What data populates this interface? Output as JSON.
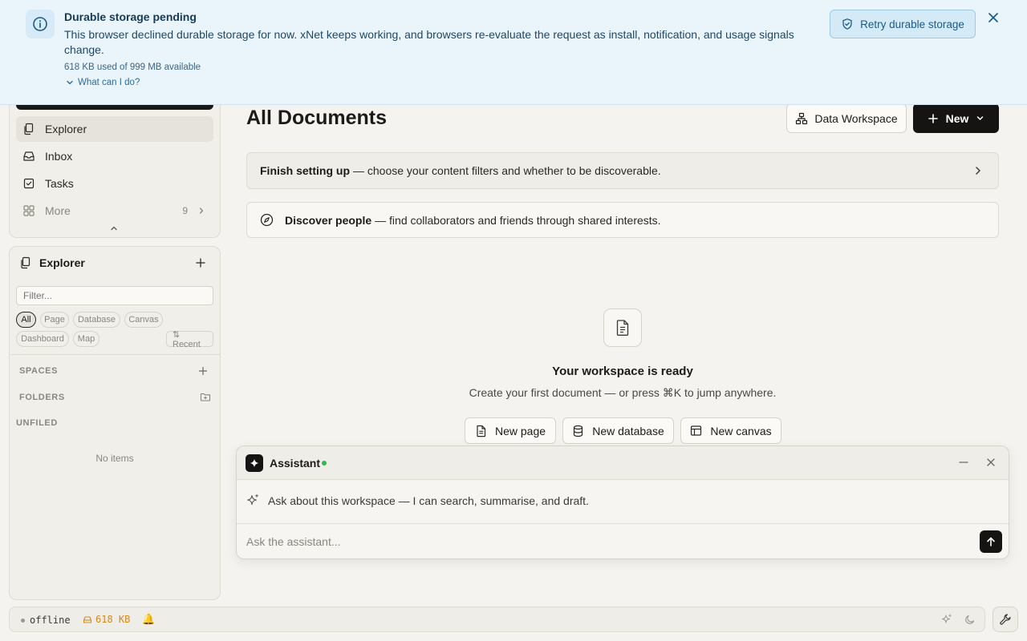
{
  "banner": {
    "title": "Durable storage pending",
    "message": "This browser declined durable storage for now. xNet keeps working, and browsers re-evaluate the request as install, notification, and usage signals change.",
    "usage": "618 KB used of 999 MB available",
    "what_can_i_do": "What can I do?",
    "retry_label": "Retry durable storage",
    "icon": "info-icon"
  },
  "sidebar": {
    "nav": [
      {
        "label": "Explorer",
        "icon": "files-icon",
        "active": true
      },
      {
        "label": "Inbox",
        "icon": "inbox-icon"
      },
      {
        "label": "Tasks",
        "icon": "checkbox-icon"
      },
      {
        "label": "More",
        "icon": "grid-icon",
        "count": "9"
      }
    ],
    "explorer": {
      "title": "Explorer",
      "filter_placeholder": "Filter...",
      "chips": [
        "All",
        "Page",
        "Database",
        "Canvas",
        "Dashboard",
        "Map"
      ],
      "sort_label": "⇅ Recent",
      "spaces_label": "SPACES",
      "folders_label": "FOLDERS",
      "unfiled_label": "UNFILED",
      "empty_text": "No items"
    }
  },
  "main": {
    "title": "All Documents",
    "data_workspace_label": "Data Workspace",
    "new_label": "New",
    "setup_bold": "Finish setting up",
    "setup_text": "— choose your content filters and whether to be discoverable.",
    "discover_bold": "Discover people",
    "discover_text": "— find collaborators and friends through shared interests.",
    "empty_title": "Your workspace is ready",
    "empty_subtitle": "Create your first document — or press ⌘K to jump anywhere.",
    "create_buttons": [
      {
        "label": "New page",
        "icon": "page-icon"
      },
      {
        "label": "New database",
        "icon": "database-icon"
      },
      {
        "label": "New canvas",
        "icon": "canvas-icon"
      }
    ]
  },
  "assistant": {
    "title": "Assistant",
    "status": "online",
    "hint": "Ask about this workspace — I can search, summarise, and draft.",
    "input_placeholder": "Ask the assistant..."
  },
  "statusbar": {
    "connection": "offline",
    "storage": "618 KB",
    "bell": "🔔"
  },
  "colors": {
    "banner_bg": "#e9f4fb",
    "accent_dark": "#151413",
    "online_green": "#34b553",
    "storage_warning": "#d48a1e"
  }
}
